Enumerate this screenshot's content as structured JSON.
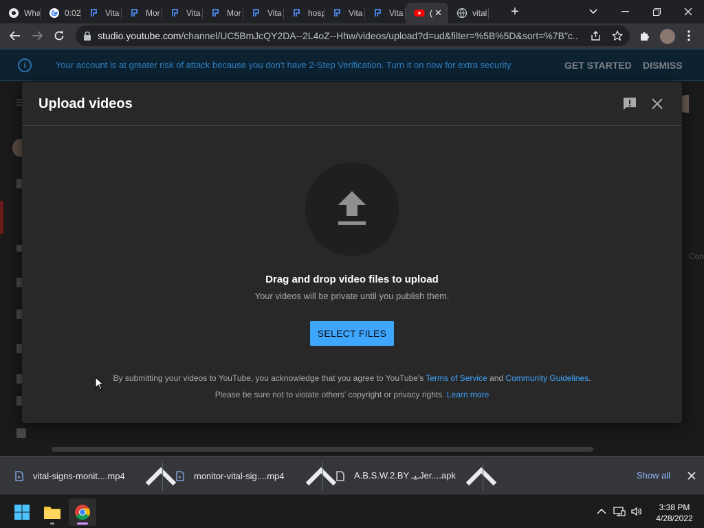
{
  "browser": {
    "tabs": [
      {
        "label": "Wha",
        "icon": "chrome-icon"
      },
      {
        "label": "0:02",
        "icon": "google-icon"
      },
      {
        "label": "Vita",
        "icon": "site-icon"
      },
      {
        "label": "Mor",
        "icon": "site-icon"
      },
      {
        "label": "Vita",
        "icon": "site-icon"
      },
      {
        "label": "Mor",
        "icon": "site-icon"
      },
      {
        "label": "Vita",
        "icon": "site-icon"
      },
      {
        "label": "hosp",
        "icon": "site-icon"
      },
      {
        "label": "Vita",
        "icon": "site-icon"
      },
      {
        "label": "Vita",
        "icon": "site-icon"
      },
      {
        "label": "(",
        "icon": "youtube-icon",
        "active": true
      },
      {
        "label": "vital",
        "icon": "globe-icon"
      }
    ],
    "url_host": "studio.youtube.com",
    "url_path": "/channel/UC5BmJcQY2DA--2L4oZ--Hhw/videos/upload?d=ud&filter=%5B%5D&sort=%7B\"c..."
  },
  "banner": {
    "message": "Your account is at greater risk of attack because you don't have 2-Step Verification. Turn it on now for extra security",
    "get_started": "GET STARTED",
    "dismiss": "DISMISS"
  },
  "studio": {
    "edge_text": "Con"
  },
  "dialog": {
    "title": "Upload videos",
    "heading": "Drag and drop video files to upload",
    "subheading": "Your videos will be private until you publish them.",
    "select_files": "SELECT FILES",
    "legal_line1_prefix": "By submitting your videos to YouTube, you acknowledge that you agree to YouTube's ",
    "terms_link": "Terms of Service",
    "legal_and": " and ",
    "guidelines_link": "Community Guidelines",
    "legal_line1_suffix": ".",
    "legal_line2_prefix": "Please be sure not to violate others' copyright or privacy rights. ",
    "learn_more": "Learn more"
  },
  "downloads": {
    "items": [
      {
        "name": "vital-signs-monit....mp4"
      },
      {
        "name": "monitor-vital-sig....mp4"
      },
      {
        "name": "A.B.S.W.2.BY ـيـJer....apk"
      }
    ],
    "show_all": "Show all"
  },
  "taskbar": {
    "time": "3:38 PM",
    "date": "4/28/2022"
  },
  "colors": {
    "accent": "#3ea6ff",
    "dialog_bg": "#282828",
    "youtube_red": "#ff0000"
  }
}
